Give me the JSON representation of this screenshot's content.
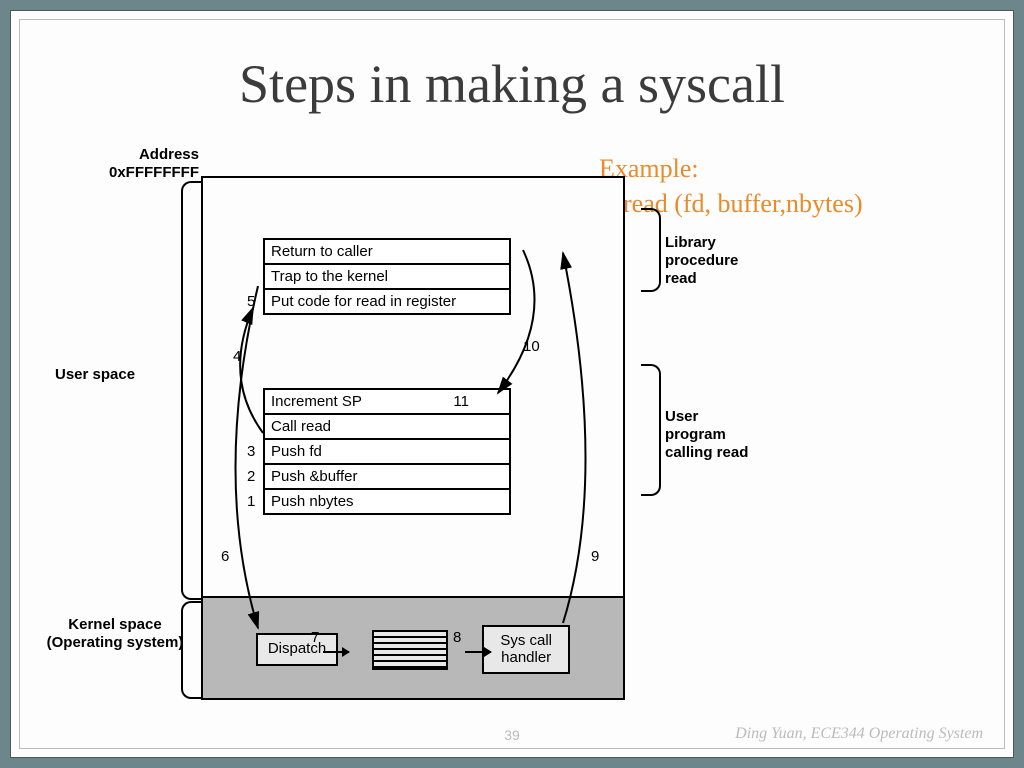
{
  "title": "Steps in making a syscall",
  "example": {
    "line1": "Example:",
    "line2": "read (fd, buffer,nbytes)"
  },
  "diagram": {
    "address_label": "Address 0xFFFFFFFF",
    "user_space_label": "User space",
    "kernel_space_label": "Kernel space (Operating system)",
    "lib_block": {
      "rows": [
        "Return to caller",
        "Trap to the kernel",
        "Put code for read in register"
      ],
      "label": "Library procedure read"
    },
    "user_block": {
      "rows": [
        {
          "text": "Increment SP",
          "inline": "11"
        },
        {
          "text": "Call read"
        },
        {
          "text": "Push fd",
          "left": "3"
        },
        {
          "text": "Push &buffer",
          "left": "2"
        },
        {
          "text": "Push nbytes",
          "left": "1"
        }
      ],
      "label": "User program calling read"
    },
    "kernel": {
      "dispatch": "Dispatch",
      "handler": "Sys call handler"
    },
    "step_labels": {
      "s4": "4",
      "s5": "5",
      "s6": "6",
      "s7": "7",
      "s8": "8",
      "s9": "9",
      "s10": "10"
    }
  },
  "footer": {
    "page": "39",
    "right": "Ding Yuan, ECE344 Operating System"
  }
}
